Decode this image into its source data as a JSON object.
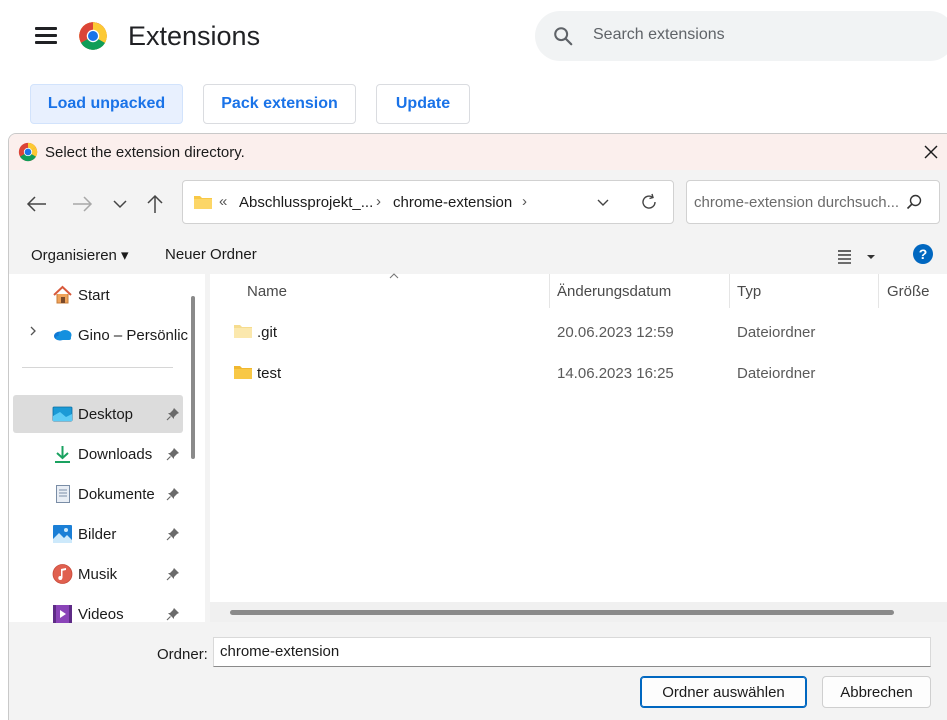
{
  "header": {
    "title": "Extensions",
    "search_placeholder": "Search extensions",
    "buttons": {
      "load_unpacked": "Load unpacked",
      "pack_extension": "Pack extension",
      "update": "Update"
    }
  },
  "dialog": {
    "title": "Select the extension directory.",
    "address": {
      "overflow": "«",
      "crumbs": [
        "Abschlussprojekt_...",
        "chrome-extension"
      ],
      "separator": "›"
    },
    "search_placeholder": "chrome-extension durchsuch...",
    "toolbar": {
      "organize": "Organisieren ▾",
      "new_folder": "Neuer Ordner"
    },
    "nav": {
      "items": [
        {
          "label": "Start",
          "icon": "home-icon",
          "pinned": false
        },
        {
          "label": "Gino – Persönlic",
          "icon": "onedrive-icon",
          "pinned": false
        },
        {
          "label": "Desktop",
          "icon": "desktop-icon",
          "pinned": true,
          "selected": true
        },
        {
          "label": "Downloads",
          "icon": "downloads-icon",
          "pinned": true
        },
        {
          "label": "Dokumente",
          "icon": "documents-icon",
          "pinned": true
        },
        {
          "label": "Bilder",
          "icon": "pictures-icon",
          "pinned": true
        },
        {
          "label": "Musik",
          "icon": "music-icon",
          "pinned": true
        },
        {
          "label": "Videos",
          "icon": "videos-icon",
          "pinned": true
        }
      ]
    },
    "columns": [
      "Name",
      "Änderungsdatum",
      "Typ",
      "Größe"
    ],
    "files": [
      {
        "name": ".git",
        "date": "20.06.2023 12:59",
        "type": "Dateiordner",
        "icon": "folder-light-icon"
      },
      {
        "name": "test",
        "date": "14.06.2023 16:25",
        "type": "Dateiordner",
        "icon": "folder-icon"
      }
    ],
    "folder_label": "Ordner:",
    "folder_value": "chrome-extension",
    "buttons": {
      "select": "Ordner auswählen",
      "cancel": "Abbrechen"
    }
  },
  "colors": {
    "accent": "#1a73e8",
    "dialog_title_bg": "#fbefed",
    "folder_yellow": "#f8c846"
  }
}
